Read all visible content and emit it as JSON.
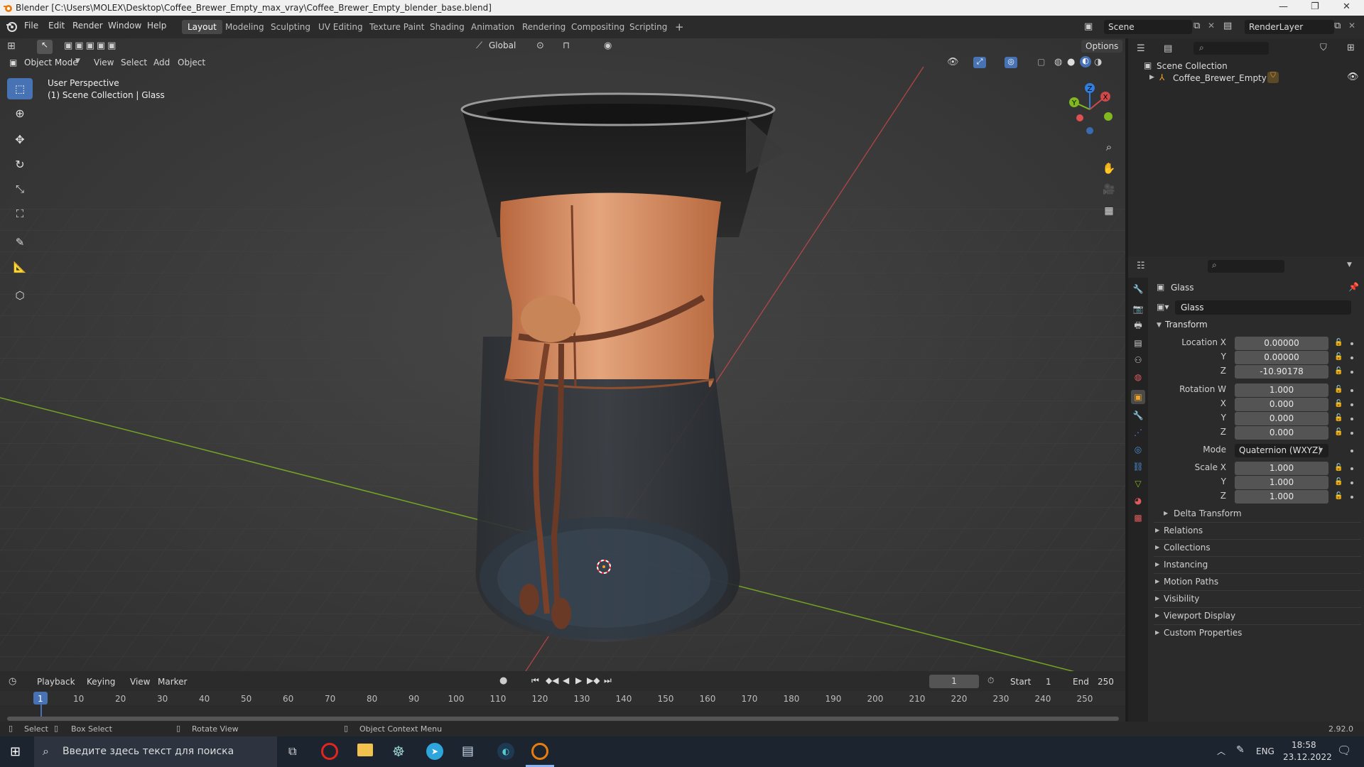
{
  "window": {
    "title": "Blender [C:\\Users\\MOLEX\\Desktop\\Coffee_Brewer_Empty_max_vray\\Coffee_Brewer_Empty_blender_base.blend]"
  },
  "menu": [
    "File",
    "Edit",
    "Render",
    "Window",
    "Help"
  ],
  "workspaces": [
    "Layout",
    "Modeling",
    "Sculpting",
    "UV Editing",
    "Texture Paint",
    "Shading",
    "Animation",
    "Rendering",
    "Compositing",
    "Scripting"
  ],
  "active_workspace": "Layout",
  "scene": {
    "name": "Scene",
    "render_layer": "RenderLayer"
  },
  "viewport": {
    "mode": "Object Mode",
    "menus": [
      "View",
      "Select",
      "Add",
      "Object"
    ],
    "transform_orientation": "Global",
    "options_label": "Options",
    "info_line1": "User Perspective",
    "info_line2": "(1) Scene Collection | Glass",
    "gizmo": {
      "x": "X",
      "y": "Y",
      "z": "Z"
    }
  },
  "outliner": {
    "root": "Scene Collection",
    "items": [
      {
        "label": "Coffee_Brewer_Empty"
      }
    ]
  },
  "properties": {
    "object_name": "Glass",
    "datablock_name": "Glass",
    "transform_header": "Transform",
    "location": {
      "label_x": "Location X",
      "label_y": "Y",
      "label_z": "Z",
      "x": "0.00000",
      "y": "0.00000",
      "z": "-10.90178"
    },
    "rotation": {
      "label_w": "Rotation W",
      "label_x": "X",
      "label_y": "Y",
      "label_z": "Z",
      "w": "1.000",
      "x": "0.000",
      "y": "0.000",
      "z": "0.000"
    },
    "mode_label": "Mode",
    "mode_value": "Quaternion (WXYZ)",
    "scale": {
      "label_x": "Scale X",
      "label_y": "Y",
      "label_z": "Z",
      "x": "1.000",
      "y": "1.000",
      "z": "1.000"
    },
    "delta_transform": "Delta Transform",
    "sections": [
      "Relations",
      "Collections",
      "Instancing",
      "Motion Paths",
      "Visibility",
      "Viewport Display",
      "Custom Properties"
    ]
  },
  "timeline": {
    "menus": [
      "Playback",
      "Keying",
      "View",
      "Marker"
    ],
    "current_frame": "1",
    "start_label": "Start",
    "start": "1",
    "end_label": "End",
    "end": "250",
    "ticks": [
      "1",
      "10",
      "20",
      "30",
      "40",
      "50",
      "60",
      "70",
      "80",
      "90",
      "100",
      "110",
      "120",
      "130",
      "140",
      "150",
      "160",
      "170",
      "180",
      "190",
      "200",
      "210",
      "220",
      "230",
      "240",
      "250"
    ]
  },
  "statusbar": {
    "select": "Select",
    "box_select": "Box Select",
    "rotate_view": "Rotate View",
    "context_menu": "Object Context Menu",
    "version": "2.92.0"
  },
  "taskbar": {
    "search_placeholder": "Введите здесь текст для поиска",
    "language": "ENG",
    "time": "18:58",
    "date": "23.12.2022"
  },
  "colors": {
    "accent": "#4772b3",
    "active_object": "#f4a020",
    "x_axis": "#d0484a",
    "y_axis": "#7fb820",
    "z_axis": "#2f7ee0"
  }
}
